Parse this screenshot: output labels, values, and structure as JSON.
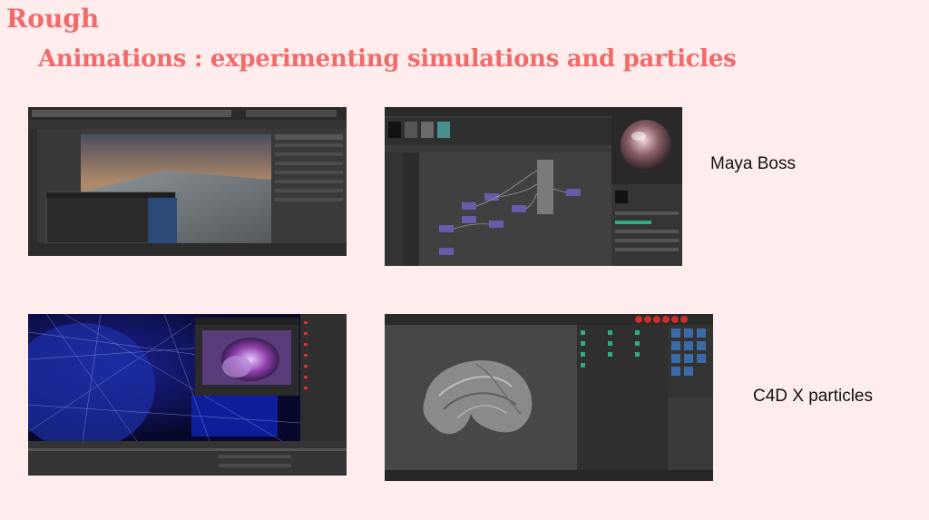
{
  "slide": {
    "heading": "Rough",
    "subheading": "Animations : experimenting simulations and particles"
  },
  "captions": {
    "maya": "Maya Boss",
    "c4d": "C4D X particles"
  },
  "colors": {
    "background": "#ffeded",
    "accent": "#f26a6a"
  }
}
